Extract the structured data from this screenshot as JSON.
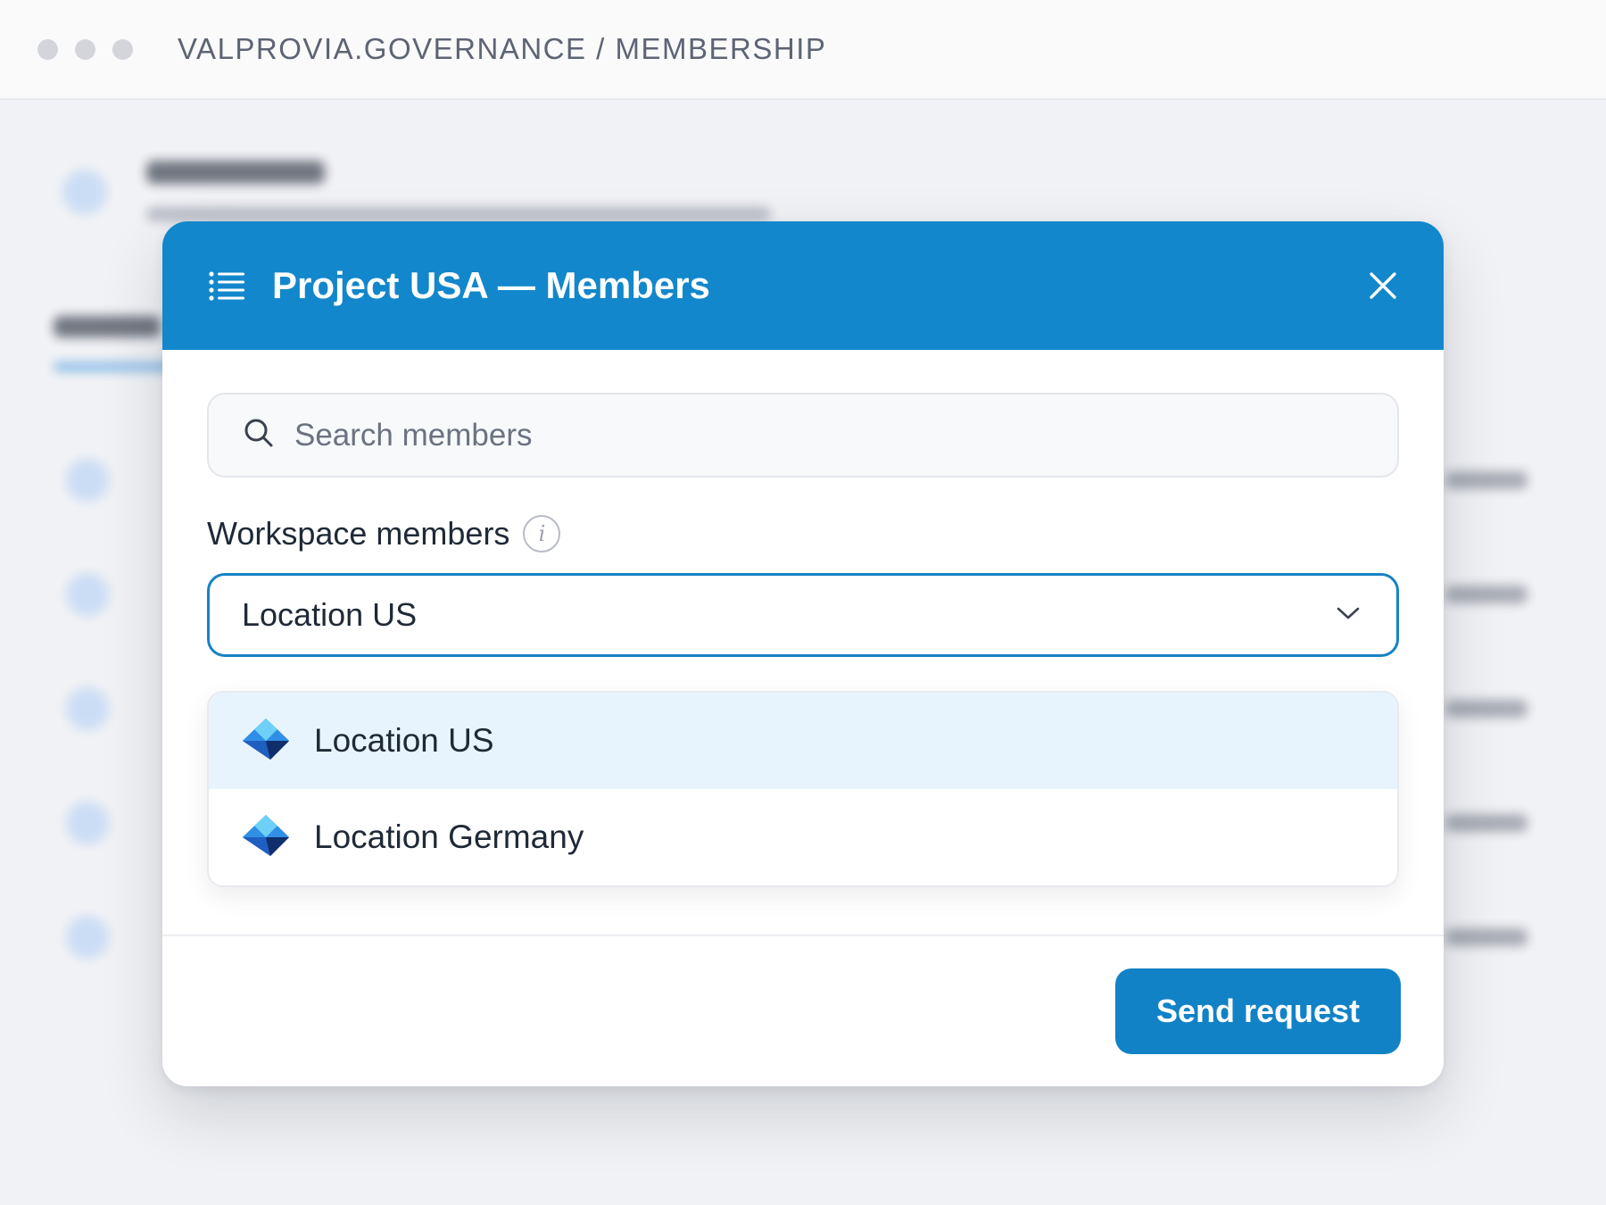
{
  "window": {
    "breadcrumb": "VALPROVIA.GOVERNANCE / MEMBERSHIP"
  },
  "modal": {
    "title": "Project USA — Members",
    "header_color": "#1287cb",
    "search": {
      "placeholder": "Search members",
      "value": ""
    },
    "workspace_label": "Workspace members",
    "info_glyph": "i",
    "select": {
      "value": "Location US"
    },
    "options": [
      {
        "label": "Location US",
        "icon": "azure-location-icon",
        "selected": true
      },
      {
        "label": "Location Germany",
        "icon": "azure-location-icon",
        "selected": false
      }
    ],
    "primary_action": "Send request",
    "accent_color": "#1282c7"
  }
}
